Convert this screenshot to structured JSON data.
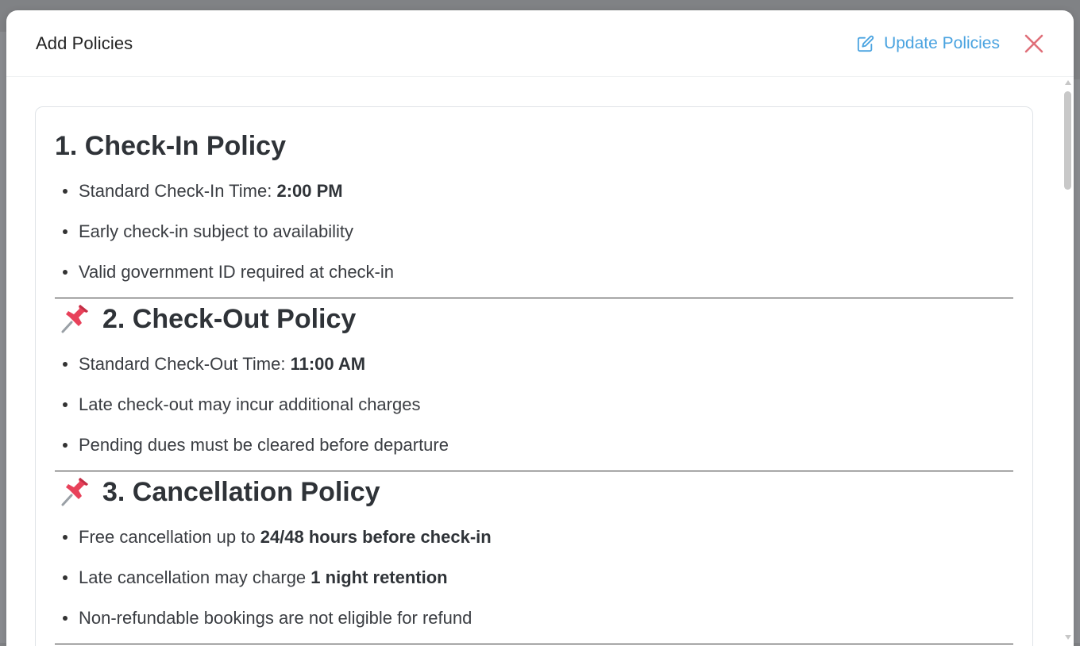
{
  "modal": {
    "title": "Add Policies",
    "update_label": "Update Policies"
  },
  "policies": [
    {
      "heading": "1. Check-In Policy",
      "has_pin": false,
      "items": [
        {
          "text": "Standard Check-In Time: ",
          "bold": "2:00 PM"
        },
        {
          "text": "Early check-in subject to availability",
          "bold": ""
        },
        {
          "text": "Valid government ID required at check-in",
          "bold": ""
        }
      ]
    },
    {
      "heading": "2. Check-Out Policy",
      "has_pin": true,
      "items": [
        {
          "text": "Standard Check-Out Time: ",
          "bold": "11:00 AM"
        },
        {
          "text": "Late check-out may incur additional charges",
          "bold": ""
        },
        {
          "text": "Pending dues must be cleared before departure",
          "bold": ""
        }
      ]
    },
    {
      "heading": "3. Cancellation Policy",
      "has_pin": true,
      "items": [
        {
          "text": "Free cancellation up to ",
          "bold": "24/48 hours before check-in"
        },
        {
          "text": "Late cancellation may charge ",
          "bold": "1 night retention"
        },
        {
          "text": "Non-refundable bookings are not eligible for refund",
          "bold": ""
        }
      ]
    }
  ],
  "colors": {
    "accent": "#4aa3e0",
    "close": "#e0707a",
    "pin": "#e8415a"
  },
  "icons": {
    "update": "edit-icon",
    "close": "close-icon",
    "pin": "pushpin-icon"
  }
}
